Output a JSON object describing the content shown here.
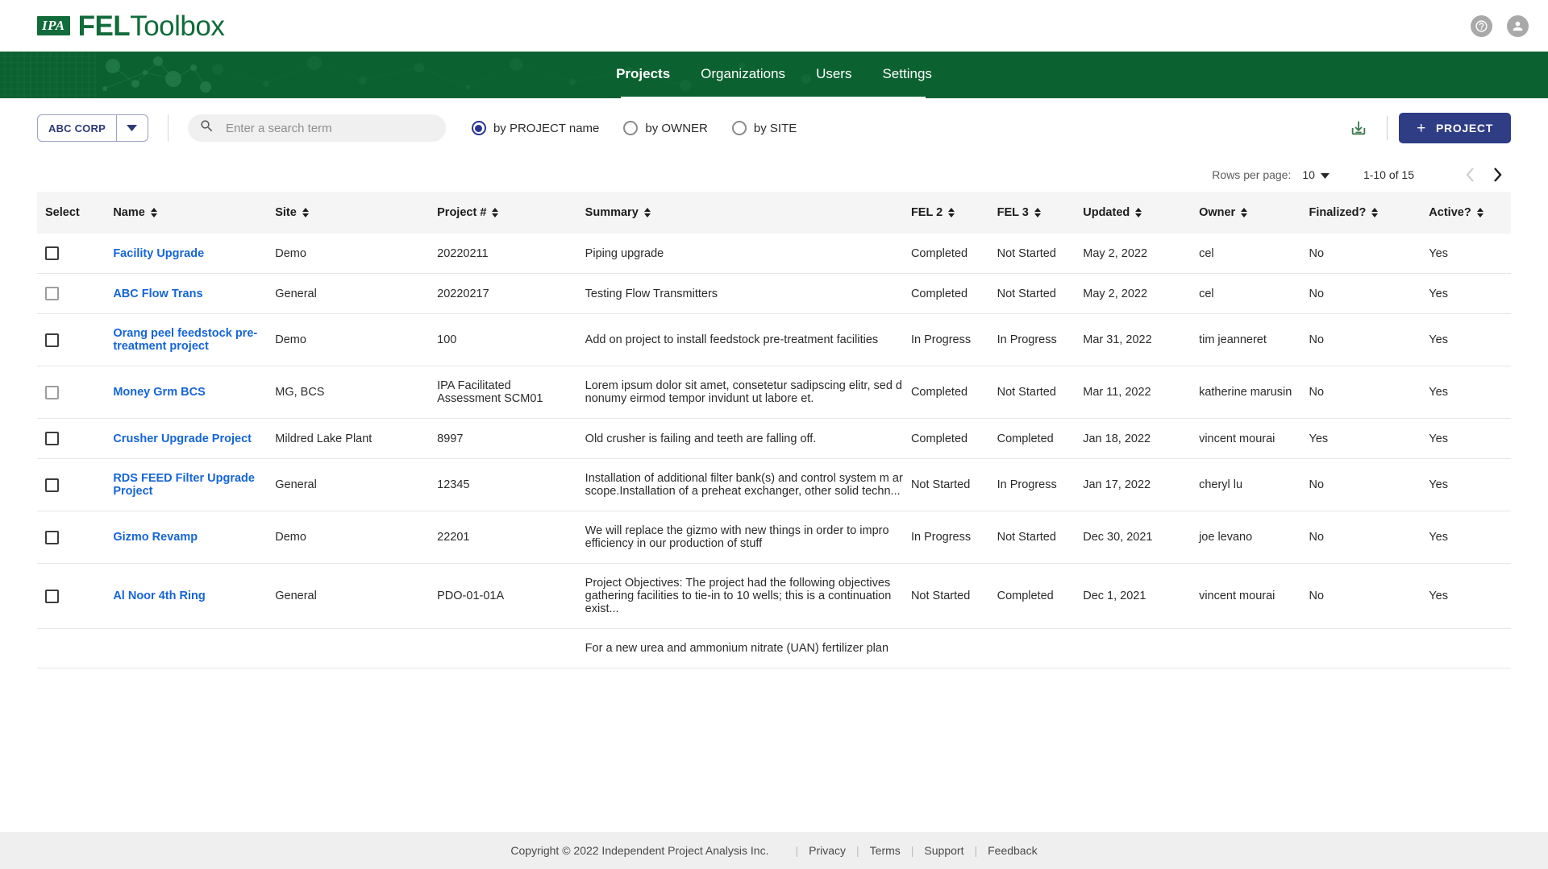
{
  "header": {
    "logo_mark": "IPA",
    "logo_bold": "FEL",
    "logo_light": "Toolbox",
    "help_icon": "help-circle-icon",
    "account_icon": "account-circle-icon"
  },
  "nav": {
    "items": [
      {
        "label": "Projects",
        "active": true
      },
      {
        "label": "Organizations",
        "active": false
      },
      {
        "label": "Users",
        "active": false
      },
      {
        "label": "Settings",
        "active": false
      }
    ]
  },
  "toolbar": {
    "org": "ABC CORP",
    "org_caret_icon": "chevron-down-icon",
    "search": {
      "icon": "search-icon",
      "value": "",
      "placeholder": "Enter a search term"
    },
    "radios": [
      {
        "label": "by PROJECT name",
        "checked": true
      },
      {
        "label": "by OWNER",
        "checked": false
      },
      {
        "label": "by SITE",
        "checked": false
      }
    ],
    "download_icon": "download-icon",
    "add_project_label": "PROJECT",
    "add_project_plus": "+",
    "accent_blue": "#2f3d85",
    "brand_green": "#0b6130",
    "link_blue": "#1565d8"
  },
  "pagination": {
    "rows_per_page_label": "Rows per page:",
    "rows_per_page_value": "10",
    "rows_caret_icon": "caret-down-icon",
    "range": "1-10 of 15",
    "prev_icon": "chevron-left-icon",
    "next_icon": "chevron-right-icon"
  },
  "table": {
    "columns": [
      {
        "label": "Select",
        "sortable": false
      },
      {
        "label": "Name",
        "sortable": true
      },
      {
        "label": "Site",
        "sortable": true
      },
      {
        "label": "Project #",
        "sortable": true
      },
      {
        "label": "Summary",
        "sortable": true
      },
      {
        "label": "FEL 2",
        "sortable": true
      },
      {
        "label": "FEL 3",
        "sortable": true
      },
      {
        "label": "Updated",
        "sortable": true
      },
      {
        "label": "Owner",
        "sortable": true
      },
      {
        "label": "Finalized?",
        "sortable": true
      },
      {
        "label": "Active?",
        "sortable": true
      }
    ],
    "rows": [
      {
        "selected": false,
        "name": "Facility Upgrade",
        "site": "Demo",
        "project_number": "20220211",
        "summary": "Piping upgrade",
        "fel2": "Completed",
        "fel3": "Not Started",
        "updated": "May 2, 2022",
        "owner": "cel",
        "finalized": "No",
        "active": "Yes"
      },
      {
        "selected": false,
        "name": "ABC Flow Trans",
        "site": "General",
        "project_number": "20220217",
        "summary": "Testing Flow Transmitters",
        "fel2": "Completed",
        "fel3": "Not Started",
        "updated": "May 2, 2022",
        "owner": "cel",
        "finalized": "No",
        "active": "Yes"
      },
      {
        "selected": false,
        "name": "Orang peel feedstock pre-treatment project",
        "site": "Demo",
        "project_number": "100",
        "summary": "Add on project to install feedstock pre-treatment facilities",
        "fel2": "In Progress",
        "fel3": "In Progress",
        "updated": "Mar 31, 2022",
        "owner": "tim jeanneret",
        "finalized": "No",
        "active": "Yes"
      },
      {
        "selected": false,
        "name": "Money Grm BCS",
        "site": "MG, BCS",
        "project_number": "IPA Facilitated Assessment SCM01",
        "summary": "Lorem ipsum dolor sit amet, consetetur sadipscing elitr, sed diam nonumy eirmod tempor invidunt ut labore et.",
        "fel2": "Completed",
        "fel3": "Not Started",
        "updated": "Mar 11, 2022",
        "owner": "katherine marusin",
        "finalized": "No",
        "active": "Yes"
      },
      {
        "selected": false,
        "name": "Crusher Upgrade Project",
        "site": "Mildred Lake Plant",
        "project_number": "8997",
        "summary": "Old crusher is failing and teeth are falling off.",
        "fel2": "Completed",
        "fel3": "Completed",
        "updated": "Jan 18, 2022",
        "owner": "vincent mourai",
        "finalized": "Yes",
        "active": "Yes"
      },
      {
        "selected": false,
        "name": "RDS FEED Filter Upgrade Project",
        "site": "General",
        "project_number": "12345",
        "summary": "Installation of additional filter bank(s) and control system m are in scope.Installation of a preheat exchanger, other solid techn...",
        "fel2": "Not Started",
        "fel3": "In Progress",
        "updated": "Jan 17, 2022",
        "owner": "cheryl lu",
        "finalized": "No",
        "active": "Yes"
      },
      {
        "selected": false,
        "name": "Gizmo Revamp",
        "site": "Demo",
        "project_number": "22201",
        "summary": "We will replace the gizmo with new things in order to impro efficiency in our production of stuff",
        "fel2": "In Progress",
        "fel3": "Not Started",
        "updated": "Dec 30, 2021",
        "owner": "joe levano",
        "finalized": "No",
        "active": "Yes"
      },
      {
        "selected": false,
        "name": "Al Noor 4th Ring",
        "site": "General",
        "project_number": "PDO-01-01A",
        "summary": "Project Objectives: The project had the following objectives gathering facilities to tie-in to 10 wells; this is a continuation exist...",
        "fel2": "Not Started",
        "fel3": "Completed",
        "updated": "Dec 1, 2021",
        "owner": "vincent mourai",
        "finalized": "No",
        "active": "Yes"
      },
      {
        "selected": false,
        "name": "",
        "site": "",
        "project_number": "",
        "summary": "For a new urea and ammonium nitrate (UAN) fertilizer plan",
        "fel2": "",
        "fel3": "",
        "updated": "",
        "owner": "",
        "finalized": "",
        "active": ""
      }
    ]
  },
  "footer": {
    "copyright": "Copyright © 2022 Independent Project Analysis Inc.",
    "links": [
      "Privacy",
      "Terms",
      "Support",
      "Feedback"
    ]
  }
}
